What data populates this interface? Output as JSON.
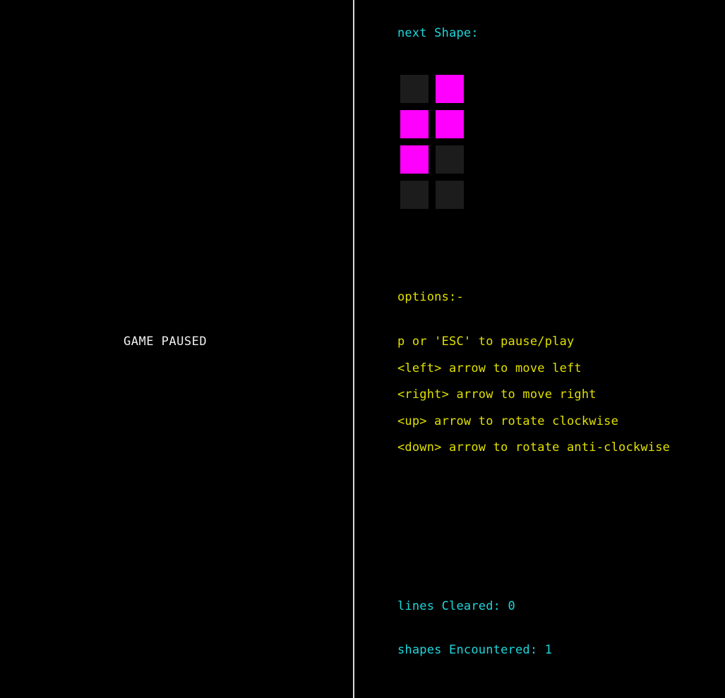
{
  "board": {
    "status_text": "GAME PAUSED"
  },
  "next_shape": {
    "label": "next Shape:",
    "grid": [
      [
        0,
        1
      ],
      [
        1,
        1
      ],
      [
        1,
        0
      ],
      [
        0,
        0
      ]
    ],
    "filled_color": "#ff00ff",
    "empty_color": "#1c1c1c"
  },
  "options": {
    "label": "options:-",
    "items": [
      "p or 'ESC' to pause/play",
      "<left> arrow to move left",
      "<right> arrow to move right",
      "<up> arrow to rotate clockwise",
      "<down> arrow to rotate anti-clockwise"
    ]
  },
  "stats": {
    "lines_cleared": "lines Cleared: 0",
    "shapes_encountered": "shapes Encountered: 1"
  },
  "colors": {
    "background": "#000000",
    "divider": "#d8d8d8",
    "cyan_text": "#1ed6dc",
    "yellow_text": "#e0e000",
    "status_text": "#f0f0f0"
  }
}
